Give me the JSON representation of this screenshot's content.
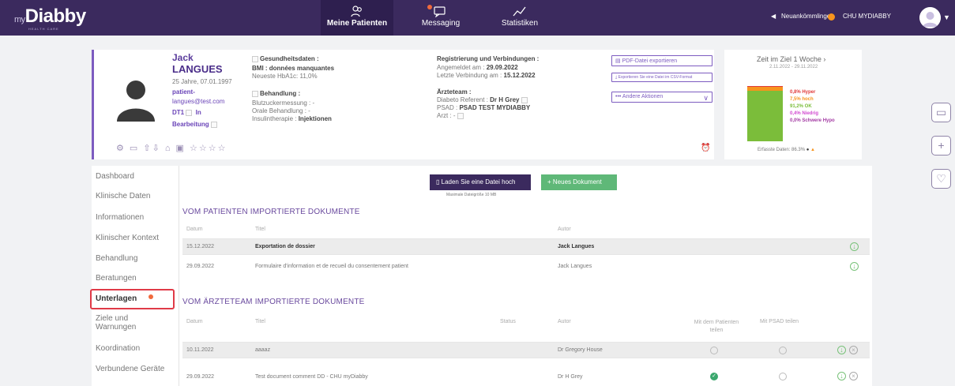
{
  "app": {
    "logo_my": "my",
    "logo": "Diabby",
    "logo_sub": "HEALTH CARE"
  },
  "nav": [
    {
      "label": "Meine Patienten"
    },
    {
      "label": "Messaging"
    },
    {
      "label": "Statistiken"
    }
  ],
  "header": {
    "newcomers": "Neuankömmlinge",
    "user": "CHU MYDIABBY"
  },
  "patient": {
    "first_name": "Jack",
    "last_name": "LANGUES",
    "age_dob": "25 Jahre, 07.01.1997",
    "email_label": "patient-",
    "email_rest": "langues@test.com",
    "dt1": "DT1",
    "dt1_in": "In",
    "edit": "Bearbeitung",
    "health_title": "Gesundheitsdaten :",
    "bmi": "BMI : données manquantes",
    "hba1c": "Neueste HbA1c: 11,0%",
    "treat_title": "Behandlung :",
    "treat1": "Blutzuckermessung : -",
    "treat2": "Orale Behandlung : -",
    "treat3_label": "Insulintherapie : ",
    "treat3_val": "Injektionen",
    "reg_title": "Registrierung und Verbindungen :",
    "reg1_label": "Angemeldet am : ",
    "reg1_val": "29.09.2022",
    "reg2_label": "Letzte Verbindung am : ",
    "reg2_val": "15.12.2022",
    "team_title": "Ärzteteam :",
    "team1_label": "Diabeto Referent : ",
    "team1_val": "Dr H Grey",
    "team2_label": "PSAD : ",
    "team2_val": "PSAD TEST MYDIABBY",
    "team3": "Arzt : -",
    "btn_pdf": "PDF-Datei exportieren",
    "btn_data": "Exportieren Sie eine Datei im CSV-Format",
    "btn_more": "Andere Aktionen"
  },
  "ziel": {
    "title": "Zeit im Ziel 1 Woche",
    "range": "2.11.2022 - 29.11.2022",
    "legend": [
      {
        "label": "0,8% Hyper",
        "color": "#e03a3a"
      },
      {
        "label": "7,5% hoch",
        "color": "#f7941d"
      },
      {
        "label": "91,2% OK",
        "color": "#7bbd3a"
      },
      {
        "label": "0,4% Niedrig",
        "color": "#d24ad1"
      },
      {
        "label": "0,0% Schwere Hypo",
        "color": "#a33aa3"
      }
    ],
    "bars": [
      {
        "value": 0.8,
        "color": "#e03a3a"
      },
      {
        "value": 7.5,
        "color": "#f7941d"
      },
      {
        "value": 91.2,
        "color": "#7bbd3a"
      }
    ],
    "footer": "Erfasste Daten: 86.3%"
  },
  "menu": [
    "Dashboard",
    "Klinische Daten",
    "Informationen",
    "Klinischer Kontext",
    "Behandlung",
    "Beratungen",
    "Unterlagen",
    "Ziele und",
    "Warnungen",
    "Koordination",
    "Verbundene Geräte"
  ],
  "docs": {
    "upload": "Laden Sie eine Datei hoch",
    "upload_hint": "Maximale Dateigröße 10 MB",
    "new_doc": "+ Neues Dokument",
    "patient_section": "VOM PATIENTEN IMPORTIERTE DOKUMENTE",
    "col_date": "Datum",
    "col_title": "Titel",
    "col_author": "Autor",
    "col_status": "Status",
    "col_share_patient": "Mit dem Patienten",
    "col_share_patient2": "teilen",
    "col_share_psad": "Mit PSAD teilen",
    "patient_rows": [
      {
        "date": "15.12.2022",
        "title": "Exportation de dossier",
        "author": "Jack Langues"
      },
      {
        "date": "29.09.2022",
        "title": "Formulaire d'information et de recueil du consentement patient",
        "author": "Jack Langues"
      }
    ],
    "team_section": "VOM ÄRZTETEAM IMPORTIERTE DOKUMENTE",
    "team_rows": [
      {
        "date": "10.11.2022",
        "title": "aaaaz",
        "author": "Dr Gregory House"
      },
      {
        "date": "29.09.2022",
        "title": "Test document comment DD - CHU myDiabby",
        "author": "Dr H Grey"
      }
    ]
  }
}
